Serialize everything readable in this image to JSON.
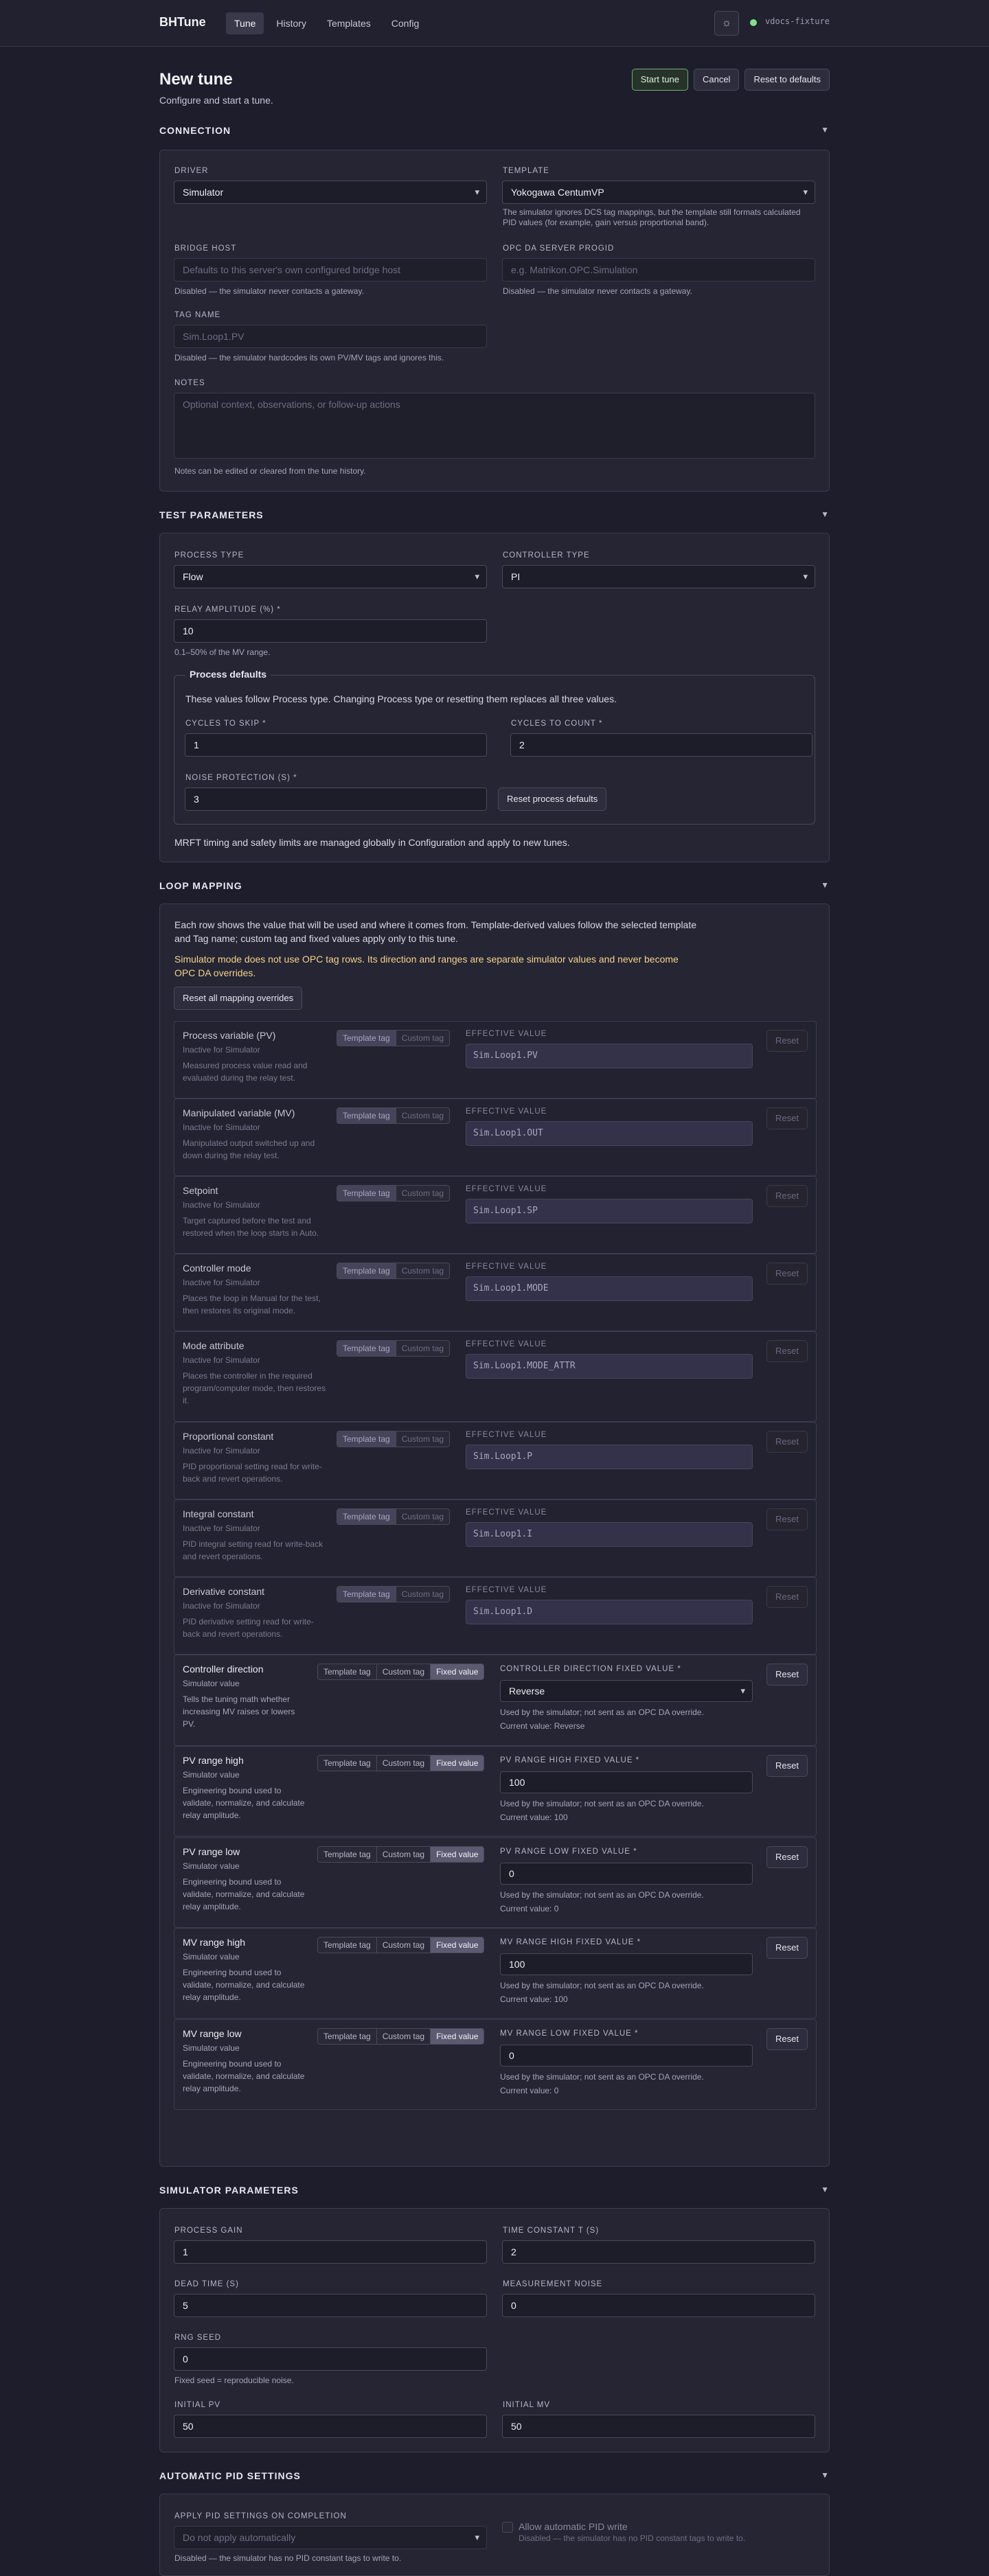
{
  "app": {
    "brand": "BHTune",
    "nav": [
      "Tune",
      "History",
      "Templates",
      "Config"
    ],
    "theme_icon": "sun-icon",
    "status": "vdocs-fixture"
  },
  "page": {
    "title": "New tune",
    "subtitle": "Configure and start a tune.",
    "actions": {
      "start": "Start tune",
      "cancel": "Cancel",
      "reset": "Reset to defaults"
    }
  },
  "connection": {
    "title": "CONNECTION",
    "driver_label": "DRIVER",
    "driver_value": "Simulator",
    "template_label": "TEMPLATE",
    "template_value": "Yokogawa CentumVP",
    "template_help": "The simulator ignores DCS tag mappings, but the template still formats calculated PID values (for example, gain versus proportional band).",
    "bridge_label": "BRIDGE HOST",
    "bridge_placeholder": "Defaults to this server's own configured bridge host",
    "bridge_help": "Disabled — the simulator never contacts a gateway.",
    "opc_label": "OPC DA SERVER PROGID",
    "opc_placeholder": "e.g. Matrikon.OPC.Simulation",
    "opc_help": "Disabled — the simulator never contacts a gateway.",
    "tag_label": "TAG NAME",
    "tag_value": "Sim.Loop1.PV",
    "tag_help": "Disabled — the simulator hardcodes its own PV/MV tags and ignores this.",
    "notes_label": "NOTES",
    "notes_placeholder": "Optional context, observations, or follow-up actions",
    "notes_help": "Notes can be edited or cleared from the tune history."
  },
  "test": {
    "title": "TEST PARAMETERS",
    "process_label": "PROCESS TYPE",
    "process_value": "Flow",
    "controller_label": "CONTROLLER TYPE",
    "controller_value": "PI",
    "relay_label": "RELAY AMPLITUDE (%) *",
    "relay_value": "10",
    "relay_help": "0.1–50% of the MV range.",
    "defaults_legend": "Process defaults",
    "defaults_note": "These values follow Process type. Changing Process type or resetting them replaces all three values.",
    "skip_label": "CYCLES TO SKIP *",
    "skip_value": "1",
    "count_label": "CYCLES TO COUNT *",
    "count_value": "2",
    "noise_label": "NOISE PROTECTION (S) *",
    "noise_value": "3",
    "reset_defaults": "Reset process defaults",
    "footer": "MRFT timing and safety limits are managed globally in Configuration and apply to new tunes."
  },
  "loop": {
    "title": "LOOP MAPPING",
    "intro": [
      "Each row shows the value that will be used and where it comes from. Template-derived values follow the selected template",
      "and Tag name; custom tag and fixed values apply only to this tune."
    ],
    "warning": [
      "Simulator mode does not use OPC tag rows. Its direction and ranges are separate simulator values and never become",
      "OPC DA overrides."
    ],
    "reset_all": "Reset all mapping overrides",
    "seg2": [
      "Template tag",
      "Custom tag"
    ],
    "seg3": [
      "Template tag",
      "Custom tag",
      "Fixed value"
    ],
    "effective_label": "EFFECTIVE VALUE",
    "reset": "Reset",
    "tag_rows": [
      {
        "title": "Process variable (PV)",
        "status": "Inactive for Simulator",
        "desc": [
          "Measured process value read and",
          "evaluated during the relay test."
        ],
        "value": "Sim.Loop1.PV"
      },
      {
        "title": "Manipulated variable (MV)",
        "status": "Inactive for Simulator",
        "desc": [
          "Manipulated output switched up and",
          "down during the relay test."
        ],
        "value": "Sim.Loop1.OUT"
      },
      {
        "title": "Setpoint",
        "status": "Inactive for Simulator",
        "desc": [
          "Target captured before the test and",
          "restored when the loop starts in Auto."
        ],
        "value": "Sim.Loop1.SP"
      },
      {
        "title": "Controller mode",
        "status": "Inactive for Simulator",
        "desc": [
          "Places the loop in Manual for the test,",
          "then restores its original mode."
        ],
        "value": "Sim.Loop1.MODE"
      },
      {
        "title": "Mode attribute",
        "status": "Inactive for Simulator",
        "desc": [
          "Places the controller in the required",
          "program/computer mode, then restores",
          "it."
        ],
        "value": "Sim.Loop1.MODE_ATTR"
      },
      {
        "title": "Proportional constant",
        "status": "Inactive for Simulator",
        "desc": [
          "PID proportional setting read for write-",
          "back and revert operations."
        ],
        "value": "Sim.Loop1.P"
      },
      {
        "title": "Integral constant",
        "status": "Inactive for Simulator",
        "desc": [
          "PID integral setting read for write-back",
          "and revert operations."
        ],
        "value": "Sim.Loop1.I"
      },
      {
        "title": "Derivative constant",
        "status": "Inactive for Simulator",
        "desc": [
          "PID derivative setting read for write-",
          "back and revert operations."
        ],
        "value": "Sim.Loop1.D"
      }
    ],
    "sim_rows": [
      {
        "title": "Controller direction",
        "status": "Simulator value",
        "desc": [
          "Tells the tuning math whether",
          "increasing MV raises or lowers",
          "PV."
        ],
        "field_label": "CONTROLLER DIRECTION FIXED VALUE *",
        "value": "Reverse",
        "help": "Used by the simulator; not sent as an OPC DA override.",
        "current": "Current value: Reverse"
      },
      {
        "title": "PV range high",
        "status": "Simulator value",
        "desc": [
          "Engineering bound used to",
          "validate, normalize, and calculate",
          "relay amplitude."
        ],
        "field_label": "PV RANGE HIGH FIXED VALUE *",
        "value": "100",
        "help": "Used by the simulator; not sent as an OPC DA override.",
        "current": "Current value: 100"
      },
      {
        "title": "PV range low",
        "status": "Simulator value",
        "desc": [
          "Engineering bound used to",
          "validate, normalize, and calculate",
          "relay amplitude."
        ],
        "field_label": "PV RANGE LOW FIXED VALUE *",
        "value": "0",
        "help": "Used by the simulator; not sent as an OPC DA override.",
        "current": "Current value: 0"
      },
      {
        "title": "MV range high",
        "status": "Simulator value",
        "desc": [
          "Engineering bound used to",
          "validate, normalize, and calculate",
          "relay amplitude."
        ],
        "field_label": "MV RANGE HIGH FIXED VALUE *",
        "value": "100",
        "help": "Used by the simulator; not sent as an OPC DA override.",
        "current": "Current value: 100"
      },
      {
        "title": "MV range low",
        "status": "Simulator value",
        "desc": [
          "Engineering bound used to",
          "validate, normalize, and calculate",
          "relay amplitude."
        ],
        "field_label": "MV RANGE LOW FIXED VALUE *",
        "value": "0",
        "help": "Used by the simulator; not sent as an OPC DA override.",
        "current": "Current value: 0"
      }
    ]
  },
  "sim": {
    "title": "SIMULATOR PARAMETERS",
    "gain_label": "PROCESS GAIN",
    "gain_value": "1",
    "tau_label": "TIME CONSTANT T (S)",
    "tau_value": "2",
    "dead_label": "DEAD TIME (S)",
    "dead_value": "5",
    "noise_label": "MEASUREMENT NOISE",
    "noise_value": "0",
    "seed_label": "RNG SEED",
    "seed_value": "0",
    "seed_help": "Fixed seed = reproducible noise.",
    "pv_label": "INITIAL PV",
    "pv_value": "50",
    "mv_label": "INITIAL MV",
    "mv_value": "50"
  },
  "auto": {
    "title": "AUTOMATIC PID SETTINGS",
    "apply_label": "APPLY PID SETTINGS ON COMPLETION",
    "apply_value": "Do not apply automatically",
    "apply_help": "Disabled — the simulator has no PID constant tags to write to.",
    "write_label": "Allow automatic PID write",
    "write_help": "Disabled — the simulator has no PID constant tags to write to."
  }
}
